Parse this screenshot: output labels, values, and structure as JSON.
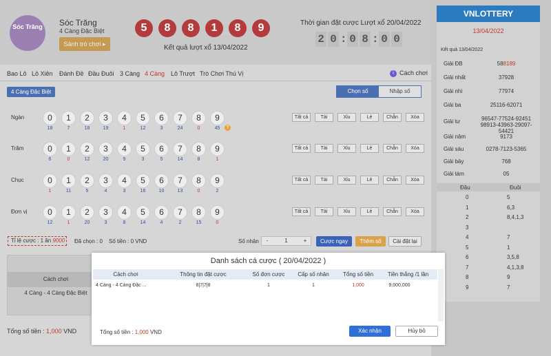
{
  "province": {
    "logo_text": "Sóc Trăng",
    "name": "Sóc Trăng",
    "subtitle": "4 Càng Đặc Biệt",
    "lobby_button": "Sảnh trò chơi ▸"
  },
  "last_result": {
    "balls": [
      "5",
      "8",
      "8",
      "1",
      "8",
      "9"
    ],
    "label": "Kết quả lượt xổ 13/04/2022"
  },
  "deadline": {
    "label": "Thời gian đặt cược Lượt xổ 20/04/2022",
    "timer": [
      "2",
      "0",
      ":",
      "0",
      "8",
      ":",
      "0",
      "0"
    ]
  },
  "nav": {
    "items": [
      "Bao Lô",
      "Lô Xiên",
      "Đánh Đề",
      "Đầu Đuôi",
      "3 Càng",
      "4 Càng",
      "Lô Trượt",
      "Trò Chơi Thú Vị"
    ],
    "howto": "Cách chơi"
  },
  "bet_type_badge": "4 Càng Đặc Biệt",
  "mode": {
    "pick": "Chọn số",
    "input": "Nhập số"
  },
  "rows": [
    {
      "label": "Ngàn",
      "counts": [
        "18",
        "7",
        "18",
        "19",
        "1",
        "12",
        "3",
        "24",
        "0",
        "45"
      ]
    },
    {
      "label": "Trăm",
      "counts": [
        "6",
        "0",
        "12",
        "20",
        "9",
        "3",
        "5",
        "14",
        "8",
        "1"
      ]
    },
    {
      "label": "Chục",
      "counts": [
        "1",
        "11",
        "5",
        "4",
        "3",
        "16",
        "10",
        "13",
        "0",
        "2"
      ]
    },
    {
      "label": "Đơn vị",
      "counts": [
        "12",
        "1",
        "20",
        "3",
        "8",
        "14",
        "4",
        "2",
        "15",
        "0"
      ]
    }
  ],
  "quick_buttons": [
    "Tất cả",
    "Tài",
    "Xỉu",
    "Lẻ",
    "Chẵn",
    "Xóa"
  ],
  "hint_icon": "?",
  "bet_bar": {
    "ratio_label": "Tỉ lệ cược : 1 ăn ",
    "ratio_value": "9000",
    "chosen": "Đã chọn : 0",
    "money": "Số tiền : 0 VND",
    "multiplier_label": "Số nhân",
    "multiplier_value": "1",
    "minus": "-",
    "plus": "+",
    "bet_now": "Cược ngay",
    "add": "Thêm số",
    "reset": "Cài đặt lại"
  },
  "bg_table": {
    "header": "Cách chơi",
    "cell": "4 Càng - 4 Càng Đặc Biệt"
  },
  "bg_total": {
    "label": "Tổng số tiền : ",
    "value": "1,000",
    "unit": " VND"
  },
  "side": {
    "logo": "VNLOTTERY",
    "date": "13/04/2022",
    "subtitle": "Kết quả 13/04/2022",
    "results": [
      {
        "k": "Giải ĐB",
        "v1": "58",
        "v2": "8189"
      },
      {
        "k": "Giải nhất",
        "v1": "37928",
        "v2": ""
      },
      {
        "k": "Giải nhì",
        "v1": "77974",
        "v2": ""
      },
      {
        "k": "Giải ba",
        "v1": "25116-62071",
        "v2": ""
      },
      {
        "k": "Giải tư",
        "v1": "96547-77524-92451",
        "v2": "98913-43963-29097-54421"
      },
      {
        "k": "Giải năm",
        "v1": "9173",
        "v2": ""
      },
      {
        "k": "Giải sáu",
        "v1": "0278-7123-5365",
        "v2": ""
      },
      {
        "k": "Giải bảy",
        "v1": "768",
        "v2": ""
      },
      {
        "k": "Giải tám",
        "v1": "05",
        "v2": ""
      }
    ],
    "head_label": "Đầu",
    "tail_label": "Đuôi",
    "heads": [
      {
        "h": "0",
        "t": "5"
      },
      {
        "h": "1",
        "t": "6,3"
      },
      {
        "h": "2",
        "t": "8,4,1,3"
      },
      {
        "h": "3",
        "t": ""
      },
      {
        "h": "4",
        "t": "7"
      },
      {
        "h": "5",
        "t": "1"
      },
      {
        "h": "6",
        "t": "3,5,8"
      },
      {
        "h": "7",
        "t": "4,1,3,8"
      },
      {
        "h": "8",
        "t": "9"
      },
      {
        "h": "9",
        "t": "7"
      }
    ]
  },
  "modal": {
    "title": "Danh sách cá cược ( 20/04/2022 )",
    "columns": [
      "Cách chơi",
      "Thông tin đặt cược",
      "Số đơn cược",
      "Cấp số nhân",
      "Tổng số tiền",
      "Tiền thắng /1 lần"
    ],
    "row": [
      "4 Càng - 4 Càng Đặc ...",
      "8|7|7|8",
      "1",
      "1",
      "1,000",
      "9,000,000"
    ],
    "total_label": "Tổng số tiền : ",
    "total_value": "1,000",
    "total_unit": " VND",
    "confirm": "Xác nhận",
    "cancel": "Hủy bỏ"
  }
}
